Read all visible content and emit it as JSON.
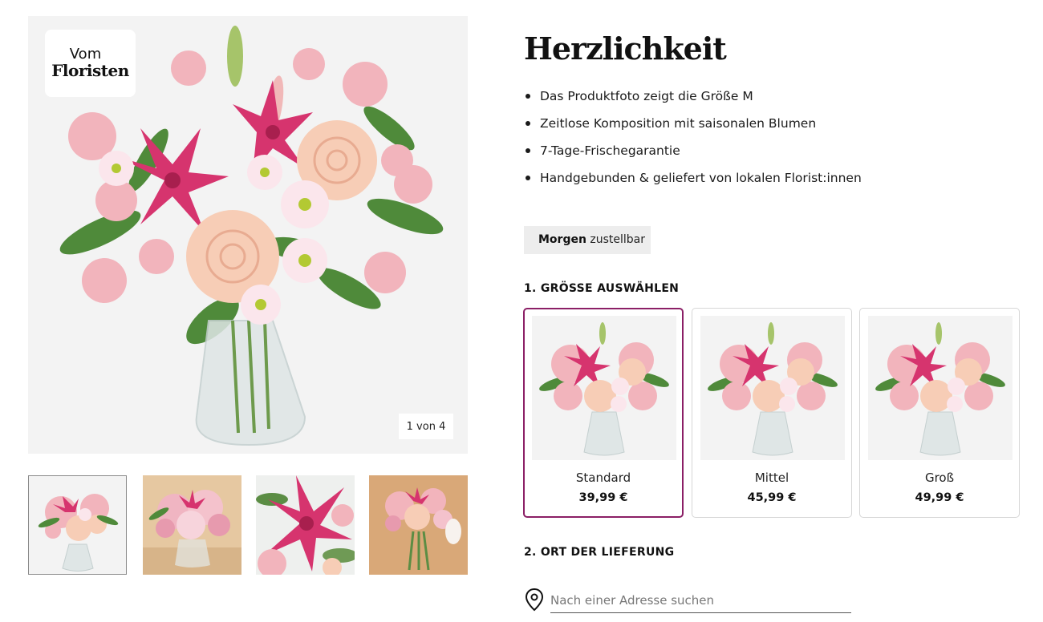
{
  "gallery": {
    "badge_line1": "Vom",
    "badge_line2": "Floristen",
    "counter": "1 von 4",
    "thumbnail_icons": [
      "bouquet-thumb-1",
      "bouquet-thumb-2",
      "bouquet-thumb-3",
      "bouquet-thumb-4"
    ],
    "active_thumbnail": 1
  },
  "product": {
    "title": "Herzlichkeit",
    "features": [
      "Das Produktfoto zeigt die Größe M",
      "Zeitlose Komposition mit saisonalen Blumen",
      "7-Tage-Frischegarantie",
      "Handgebunden & geliefert von lokalen Florist:innen"
    ],
    "delivery_strong": "Morgen",
    "delivery_rest": "zustellbar"
  },
  "size_section": {
    "heading": "1. GRÖSSE AUSWÄHLEN",
    "options": [
      {
        "name": "Standard",
        "price": "39,99 €",
        "selected": true
      },
      {
        "name": "Mittel",
        "price": "45,99 €",
        "selected": false
      },
      {
        "name": "Groß",
        "price": "49,99 €",
        "selected": false
      }
    ]
  },
  "location_section": {
    "heading": "2. ORT DER LIEFERUNG",
    "search_placeholder": "Nach einer Adresse suchen",
    "search_value": ""
  },
  "colors": {
    "selected_border": "#8b1f66",
    "image_background": "#f3f3f3",
    "badge_background": "#ededed"
  }
}
